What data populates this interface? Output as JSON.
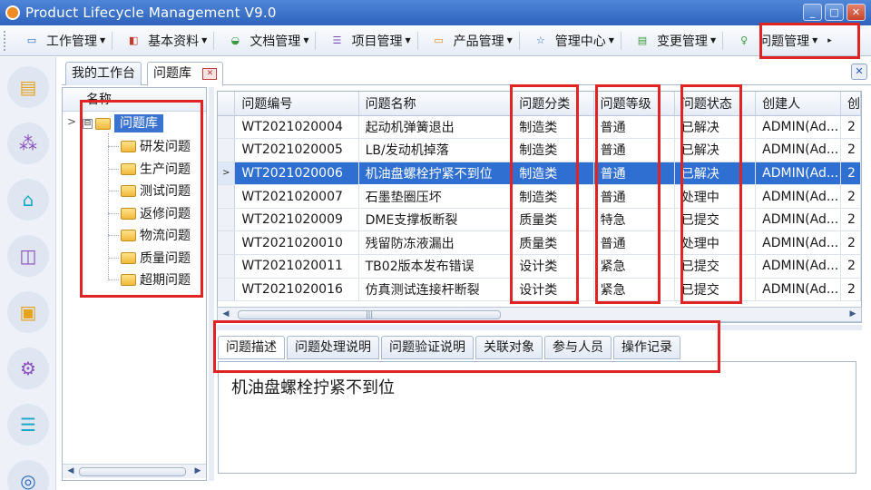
{
  "window": {
    "title": "Product Lifecycle Management V9.0",
    "min": "_",
    "max": "□",
    "close": "✕"
  },
  "menu": {
    "items": [
      {
        "label": "工作管理",
        "icon": "▭",
        "color": "#2b6cc4"
      },
      {
        "label": "基本资料",
        "icon": "◧",
        "color": "#c0392b"
      },
      {
        "label": "文档管理",
        "icon": "◒",
        "color": "#3a9a3a"
      },
      {
        "label": "项目管理",
        "icon": "☰",
        "color": "#7b4bb8"
      },
      {
        "label": "产品管理",
        "icon": "▭",
        "color": "#e08a1e"
      },
      {
        "label": "管理中心",
        "icon": "☆",
        "color": "#2b6cc4"
      },
      {
        "label": "变更管理",
        "icon": "▤",
        "color": "#3a9a3a"
      },
      {
        "label": "问题管理",
        "icon": "♀",
        "color": "#3a9a3a"
      }
    ],
    "more": "▸"
  },
  "leftbar": {
    "icons": [
      {
        "glyph": "▤",
        "color": "#e7a21e"
      },
      {
        "glyph": "⁂",
        "color": "#8a4fc0"
      },
      {
        "glyph": "⌂",
        "color": "#1aa7c7"
      },
      {
        "glyph": "◫",
        "color": "#8a4fc0"
      },
      {
        "glyph": "▣",
        "color": "#e7a21e"
      },
      {
        "glyph": "⚙",
        "color": "#8a4fc0"
      },
      {
        "glyph": "☰",
        "color": "#1aa7c7"
      },
      {
        "glyph": "◎",
        "color": "#2b6cc4"
      }
    ]
  },
  "tabs": {
    "workbench": "我的工作台",
    "issue_lib": "问题库",
    "close": "✕",
    "panel_close": "✕"
  },
  "tree": {
    "header": "名称",
    "row_marker": ">",
    "expander": "⊟",
    "root": "问题库",
    "children": [
      "研发问题",
      "生产问题",
      "测试问题",
      "返修问题",
      "物流问题",
      "质量问题",
      "超期问题"
    ]
  },
  "grid": {
    "columns": [
      "问题编号",
      "问题名称",
      "问题分类",
      "问题等级",
      "问题状态",
      "创建人",
      "创"
    ],
    "row_marker": ">",
    "rows": [
      [
        "WT2021020004",
        "起动机弹簧退出",
        "制造类",
        "普通",
        "已解决",
        "ADMIN(Ad...",
        "2"
      ],
      [
        "WT2021020005",
        "LB/发动机掉落",
        "制造类",
        "普通",
        "已解决",
        "ADMIN(Ad...",
        "2"
      ],
      [
        "WT2021020006",
        "机油盘螺栓拧紧不到位",
        "制造类",
        "普通",
        "已解决",
        "ADMIN(Ad...",
        "2"
      ],
      [
        "WT2021020007",
        "石墨垫圈压坏",
        "制造类",
        "普通",
        "处理中",
        "ADMIN(Ad...",
        "2"
      ],
      [
        "WT2021020009",
        "DME支撑板断裂",
        "质量类",
        "特急",
        "已提交",
        "ADMIN(Ad...",
        "2"
      ],
      [
        "WT2021020010",
        "残留防冻液漏出",
        "质量类",
        "普通",
        "处理中",
        "ADMIN(Ad...",
        "2"
      ],
      [
        "WT2021020011",
        "TB02版本发布错误",
        "设计类",
        "紧急",
        "已提交",
        "ADMIN(Ad...",
        "2"
      ],
      [
        "WT2021020016",
        "仿真测试连接杆断裂",
        "设计类",
        "紧急",
        "已提交",
        "ADMIN(Ad...",
        "2"
      ]
    ],
    "selected_index": 2,
    "scroll_left": "◀",
    "scroll_right": "▶",
    "scroll_grip": "|||"
  },
  "detail": {
    "tabs": [
      "问题描述",
      "问题处理说明",
      "问题验证说明",
      "关联对象",
      "参与人员",
      "操作记录"
    ],
    "active_tab": 0,
    "content": "机油盘螺栓拧紧不到位"
  },
  "tree_scroll": {
    "left": "◀",
    "right": "▶",
    "grip": "|||"
  },
  "highlight_color": "#e02424"
}
